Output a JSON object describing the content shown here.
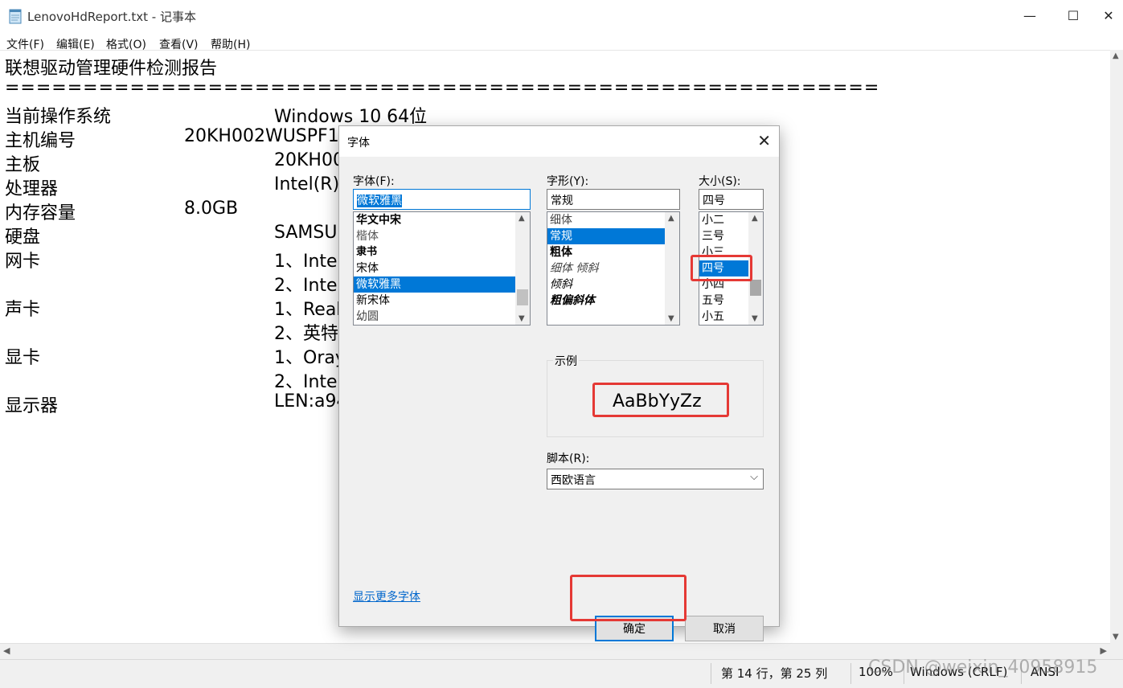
{
  "window": {
    "title": "LenovoHdReport.txt - 记事本",
    "icon": "notepad-icon",
    "controls": {
      "minimize": "—",
      "maximize": "☐",
      "close": "✕"
    }
  },
  "menu": {
    "file": "文件(F)",
    "edit": "编辑(E)",
    "format": "格式(O)",
    "view": "查看(V)",
    "help": "帮助(H)"
  },
  "document": {
    "heading": "联想驱动管理硬件检测报告",
    "separator": "========================================================",
    "rows": [
      {
        "label": "当前操作系统",
        "value": "Windows 10 64位"
      },
      {
        "label": "主机编号",
        "value": "20KH002WUSPF1"
      },
      {
        "label": "主板",
        "value": "20KH00"
      },
      {
        "label": "处理器",
        "value": "Intel(R)"
      },
      {
        "label": "内存容量",
        "value": "8.0GB"
      },
      {
        "label": "硬盘",
        "value": "SAMSU"
      },
      {
        "label": "网卡",
        "value": "1、Inte"
      },
      {
        "label": "",
        "value": "2、Inte"
      },
      {
        "label": "声卡",
        "value": "1、Real"
      },
      {
        "label": "",
        "value": "2、英特"
      },
      {
        "label": "显卡",
        "value": "1、Oray"
      },
      {
        "label": "",
        "value": "2、Inte"
      },
      {
        "label": "显示器",
        "value": "LEN:a94"
      }
    ]
  },
  "statusbar": {
    "position": "第 14 行，第 25 列",
    "zoom": "100%",
    "line_ending": "Windows (CRLF)",
    "encoding": "ANSI",
    "watermark": "CSDN @weixin_40958915"
  },
  "font_dialog": {
    "title": "字体",
    "font_label": "字体(F):",
    "font_value": "微软雅黑",
    "font_list": [
      "华文中宋",
      "楷体",
      "隶书",
      "宋体",
      "微软雅黑",
      "新宋体",
      "幼圆"
    ],
    "font_selected": "微软雅黑",
    "style_label": "字形(Y):",
    "style_value": "常规",
    "style_list": [
      "细体",
      "常规",
      "粗体",
      "细体 倾斜",
      "倾斜",
      "粗偏斜体"
    ],
    "style_selected": "常规",
    "size_label": "大小(S):",
    "size_value": "四号",
    "size_list": [
      "小二",
      "三号",
      "小三",
      "四号",
      "小四",
      "五号",
      "小五"
    ],
    "size_selected": "四号",
    "sample_label": "示例",
    "sample_text": "AaBbYyZz",
    "script_label": "脚本(R):",
    "script_value": "西欧语言",
    "more_fonts_link": "显示更多字体",
    "ok_button": "确定",
    "cancel_button": "取消"
  },
  "accent": {
    "selection": "#0078d7",
    "highlight_box": "#e53935"
  }
}
